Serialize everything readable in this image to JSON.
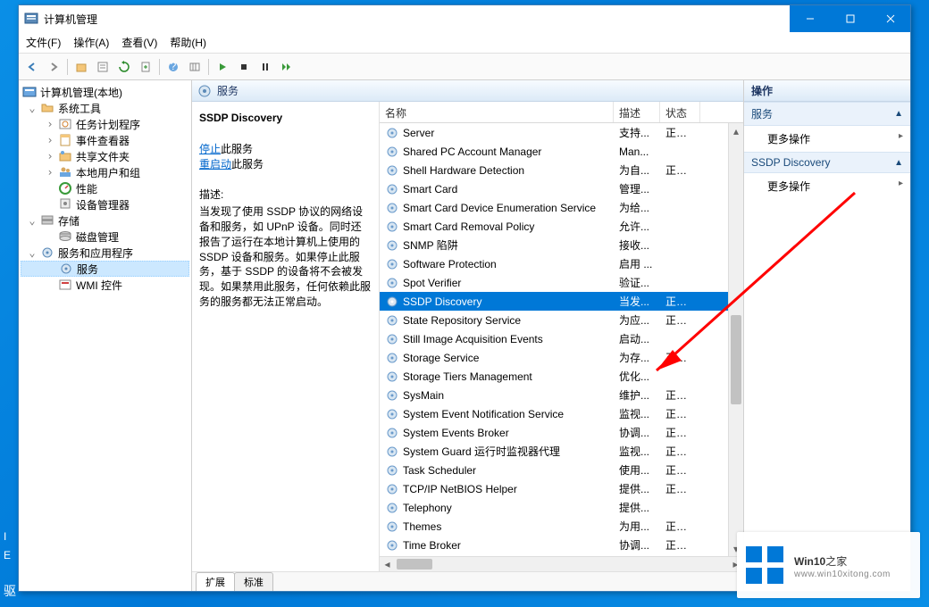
{
  "window": {
    "title": "计算机管理"
  },
  "menubar": [
    "文件(F)",
    "操作(A)",
    "查看(V)",
    "帮助(H)"
  ],
  "sidebar": {
    "root": "计算机管理(本地)",
    "groups": [
      {
        "label": "系统工具",
        "expanded": true,
        "children": [
          {
            "label": "任务计划程序",
            "icon": "clock"
          },
          {
            "label": "事件查看器",
            "icon": "event"
          },
          {
            "label": "共享文件夹",
            "icon": "share"
          },
          {
            "label": "本地用户和组",
            "icon": "users"
          },
          {
            "label": "性能",
            "icon": "perf"
          },
          {
            "label": "设备管理器",
            "icon": "device"
          }
        ]
      },
      {
        "label": "存储",
        "expanded": true,
        "children": [
          {
            "label": "磁盘管理",
            "icon": "disk"
          }
        ]
      },
      {
        "label": "服务和应用程序",
        "expanded": true,
        "children": [
          {
            "label": "服务",
            "icon": "gear",
            "selected": true
          },
          {
            "label": "WMI 控件",
            "icon": "wmi"
          }
        ]
      }
    ]
  },
  "center": {
    "header": "服务",
    "detail": {
      "title": "SSDP Discovery",
      "stop_prefix": "停止",
      "stop_suffix": "此服务",
      "restart_prefix": "重启动",
      "restart_suffix": "此服务",
      "desc_label": "描述:",
      "desc_text": "当发现了使用 SSDP 协议的网络设备和服务，如 UPnP 设备。同时还报告了运行在本地计算机上使用的 SSDP 设备和服务。如果停止此服务，基于 SSDP 的设备将不会被发现。如果禁用此服务，任何依赖此服务的服务都无法正常启动。"
    },
    "columns": {
      "name": "名称",
      "desc": "描述",
      "status": "状态"
    },
    "services": [
      {
        "name": "Server",
        "desc": "支持...",
        "status": "正在..."
      },
      {
        "name": "Shared PC Account Manager",
        "desc": "Man...",
        "status": ""
      },
      {
        "name": "Shell Hardware Detection",
        "desc": "为自...",
        "status": "正在..."
      },
      {
        "name": "Smart Card",
        "desc": "管理...",
        "status": ""
      },
      {
        "name": "Smart Card Device Enumeration Service",
        "desc": "为给...",
        "status": ""
      },
      {
        "name": "Smart Card Removal Policy",
        "desc": "允许...",
        "status": ""
      },
      {
        "name": "SNMP 陷阱",
        "desc": "接收...",
        "status": ""
      },
      {
        "name": "Software Protection",
        "desc": "启用 ...",
        "status": ""
      },
      {
        "name": "Spot Verifier",
        "desc": "验证...",
        "status": ""
      },
      {
        "name": "SSDP Discovery",
        "desc": "当发...",
        "status": "正在...",
        "selected": true
      },
      {
        "name": "State Repository Service",
        "desc": "为应...",
        "status": "正在..."
      },
      {
        "name": "Still Image Acquisition Events",
        "desc": "启动...",
        "status": ""
      },
      {
        "name": "Storage Service",
        "desc": "为存...",
        "status": "正在..."
      },
      {
        "name": "Storage Tiers Management",
        "desc": "优化...",
        "status": ""
      },
      {
        "name": "SysMain",
        "desc": "维护...",
        "status": "正在..."
      },
      {
        "name": "System Event Notification Service",
        "desc": "监视...",
        "status": "正在..."
      },
      {
        "name": "System Events Broker",
        "desc": "协调...",
        "status": "正在..."
      },
      {
        "name": "System Guard 运行时监视器代理",
        "desc": "监视...",
        "status": "正在..."
      },
      {
        "name": "Task Scheduler",
        "desc": "使用...",
        "status": "正在..."
      },
      {
        "name": "TCP/IP NetBIOS Helper",
        "desc": "提供...",
        "status": "正在..."
      },
      {
        "name": "Telephony",
        "desc": "提供...",
        "status": ""
      },
      {
        "name": "Themes",
        "desc": "为用...",
        "status": "正在..."
      },
      {
        "name": "Time Broker",
        "desc": "协调...",
        "status": "正在..."
      }
    ],
    "tabs": [
      "扩展",
      "标准"
    ]
  },
  "actions": {
    "title": "操作",
    "sections": [
      {
        "header": "服务",
        "items": [
          "更多操作"
        ]
      },
      {
        "header": "SSDP Discovery",
        "items": [
          "更多操作"
        ]
      }
    ]
  },
  "watermark": {
    "brand": "Win10",
    "suffix": "之家",
    "url": "www.win10xitong.com"
  },
  "desktop": {
    "line1": "I",
    "line2": "E",
    "line3": "驱"
  }
}
